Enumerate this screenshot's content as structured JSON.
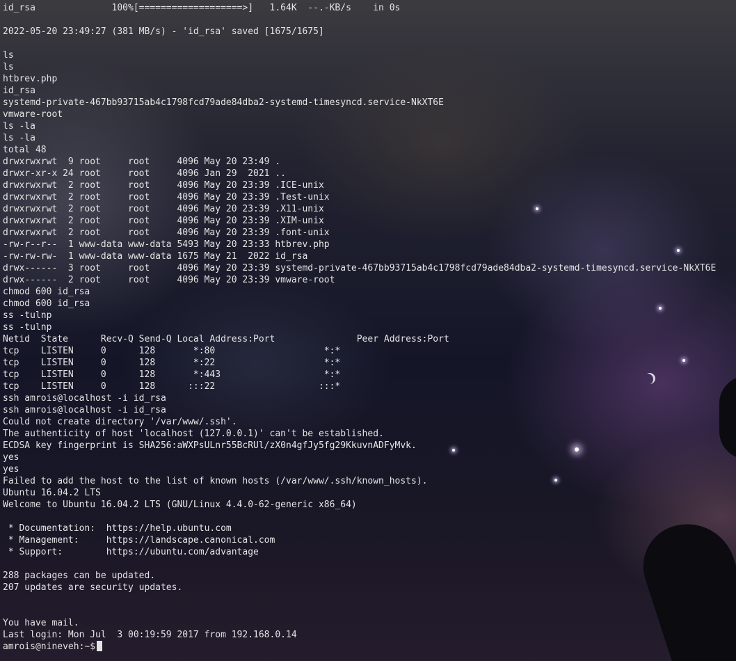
{
  "terminal": {
    "lines": [
      "id_rsa              100%[===================>]   1.64K  --.-KB/s    in 0s",
      "",
      "2022-05-20 23:49:27 (381 MB/s) - 'id_rsa' saved [1675/1675]",
      "",
      "ls",
      "ls",
      "htbrev.php",
      "id_rsa",
      "systemd-private-467bb93715ab4c1798fcd79ade84dba2-systemd-timesyncd.service-NkXT6E",
      "vmware-root",
      "ls -la",
      "ls -la",
      "total 48",
      "drwxrwxrwt  9 root     root     4096 May 20 23:49 .",
      "drwxr-xr-x 24 root     root     4096 Jan 29  2021 ..",
      "drwxrwxrwt  2 root     root     4096 May 20 23:39 .ICE-unix",
      "drwxrwxrwt  2 root     root     4096 May 20 23:39 .Test-unix",
      "drwxrwxrwt  2 root     root     4096 May 20 23:39 .X11-unix",
      "drwxrwxrwt  2 root     root     4096 May 20 23:39 .XIM-unix",
      "drwxrwxrwt  2 root     root     4096 May 20 23:39 .font-unix",
      "-rw-r--r--  1 www-data www-data 5493 May 20 23:33 htbrev.php",
      "-rw-rw-rw-  1 www-data www-data 1675 May 21  2022 id_rsa",
      "drwx------  3 root     root     4096 May 20 23:39 systemd-private-467bb93715ab4c1798fcd79ade84dba2-systemd-timesyncd.service-NkXT6E",
      "drwx------  2 root     root     4096 May 20 23:39 vmware-root",
      "chmod 600 id_rsa",
      "chmod 600 id_rsa",
      "ss -tulnp",
      "ss -tulnp",
      "Netid  State      Recv-Q Send-Q Local Address:Port               Peer Address:Port",
      "tcp    LISTEN     0      128       *:80                    *:*",
      "tcp    LISTEN     0      128       *:22                    *:*",
      "tcp    LISTEN     0      128       *:443                   *:*",
      "tcp    LISTEN     0      128      :::22                   :::*",
      "ssh amrois@localhost -i id_rsa",
      "ssh amrois@localhost -i id_rsa",
      "Could not create directory '/var/www/.ssh'.",
      "The authenticity of host 'localhost (127.0.0.1)' can't be established.",
      "ECDSA key fingerprint is SHA256:aWXPsULnr55BcRUl/zX0n4gfJy5fg29KkuvnADFyMvk.",
      "yes",
      "yes",
      "Failed to add the host to the list of known hosts (/var/www/.ssh/known_hosts).",
      "Ubuntu 16.04.2 LTS",
      "Welcome to Ubuntu 16.04.2 LTS (GNU/Linux 4.4.0-62-generic x86_64)",
      "",
      " * Documentation:  https://help.ubuntu.com",
      " * Management:     https://landscape.canonical.com",
      " * Support:        https://ubuntu.com/advantage",
      "",
      "288 packages can be updated.",
      "207 updates are security updates.",
      "",
      "",
      "You have mail.",
      "Last login: Mon Jul  3 00:19:59 2017 from 192.168.0.14"
    ],
    "prompt": "amrois@nineveh:~$",
    "input_value": ""
  },
  "colors": {
    "foreground": "#e4e4e4",
    "cursor": "#e4e4e4"
  }
}
